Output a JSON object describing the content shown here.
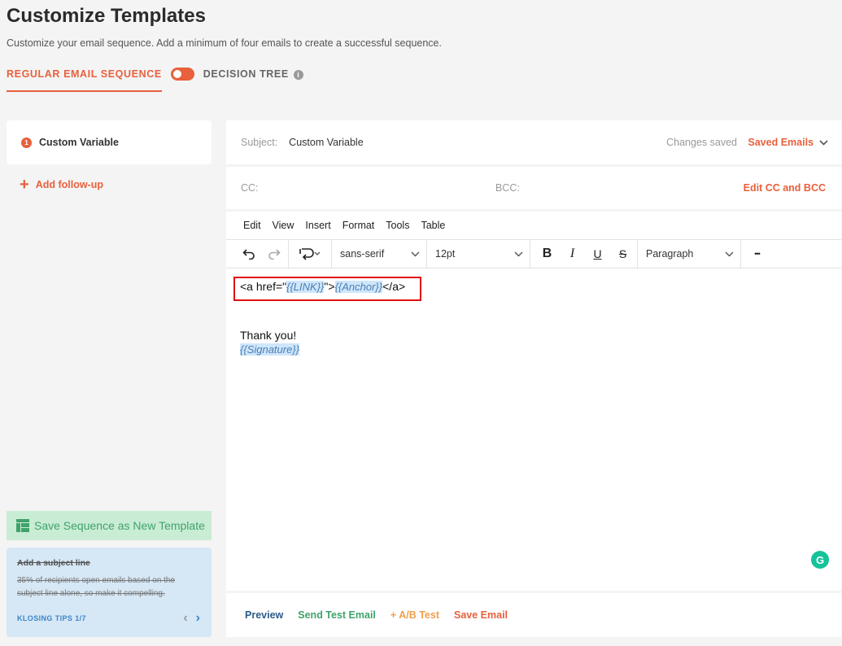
{
  "header": {
    "title": "Customize Templates",
    "subtitle": "Customize your email sequence. Add a minimum of four emails to create a successful sequence."
  },
  "modes": {
    "regular": "REGULAR EMAIL SEQUENCE",
    "decision_tree": "DECISION TREE",
    "info_icon": "i"
  },
  "sequence": {
    "items": [
      {
        "number": "1",
        "label": "Custom Variable"
      }
    ],
    "add_followup_icon": "+",
    "add_followup": "Add follow-up",
    "save_template": "Save Sequence as New Template"
  },
  "tips": {
    "title": "Add a subject line",
    "body": "35% of recipients open emails based on the subject line alone, so make it compelling.",
    "counter": "KLOSING TIPS 1/7",
    "prev_icon": "‹",
    "next_icon": "›"
  },
  "email": {
    "subject_label": "Subject:",
    "subject_value": "Custom Variable",
    "status": "Changes saved",
    "saved_emails": "Saved Emails",
    "cc_label": "CC:",
    "bcc_label": "BCC:",
    "edit_cc_bcc": "Edit CC and BCC"
  },
  "editor": {
    "menu": [
      "Edit",
      "View",
      "Insert",
      "Format",
      "Tools",
      "Table"
    ],
    "font": "sans-serif",
    "size": "12pt",
    "block": "Paragraph",
    "bold_glyph": "B",
    "italic_glyph": "I",
    "underline_glyph": "U",
    "strike_glyph": "S",
    "more_glyph": "•••",
    "content": {
      "code_prefix": "<a href=\"",
      "link_var": "{{LINK}}",
      "code_mid": "\">",
      "anchor_var": "{{Anchor}}",
      "code_suffix": "</a>",
      "thanks": "Thank you!",
      "signature_var": "{{Signature}}"
    },
    "grammarly_glyph": "G"
  },
  "actions": {
    "preview": "Preview",
    "send_test": "Send Test Email",
    "ab_test": "+ A/B Test",
    "save": "Save Email"
  },
  "colors": {
    "accent": "#e8603c",
    "green": "#3fa36b",
    "blue": "#2b5c8a",
    "orange": "#f0a04b",
    "highlight_border": "#e01010"
  }
}
